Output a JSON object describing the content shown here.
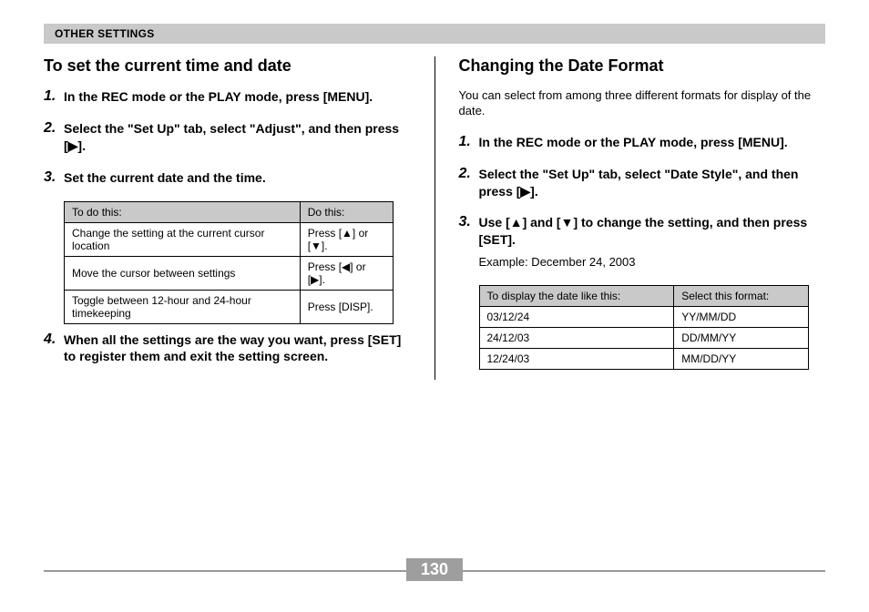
{
  "header": "OTHER SETTINGS",
  "glyph": {
    "up": "▲",
    "down": "▼",
    "left": "◀",
    "right": "▶"
  },
  "left": {
    "title": "To set the current time and date",
    "steps": [
      "In the REC mode or the PLAY mode, press [MENU].",
      "Select the \"Set Up\" tab, select \"Adjust\", and then press [▶].",
      "Set the current date and the time.",
      "When all the settings are the way you want, press [SET] to register them and exit the setting screen."
    ],
    "table": {
      "head": [
        "To do this:",
        "Do this:"
      ],
      "rows": [
        [
          "Change the setting at the current cursor location",
          "Press [▲] or [▼]."
        ],
        [
          "Move the cursor between settings",
          "Press [◀] or [▶]."
        ],
        [
          "Toggle between 12-hour and 24-hour timekeeping",
          "Press [DISP]."
        ]
      ]
    }
  },
  "right": {
    "title": "Changing the Date Format",
    "intro": "You can select from among three different formats for display of the date.",
    "steps": [
      "In the REC mode or the PLAY mode, press [MENU].",
      "Select the \"Set Up\" tab, select \"Date Style\", and then press [▶].",
      "Use [▲] and [▼] to change the setting, and then press [SET]."
    ],
    "example": "Example: December 24, 2003",
    "table": {
      "head": [
        "To display the date like this:",
        "Select this format:"
      ],
      "rows": [
        [
          "03/12/24",
          "YY/MM/DD"
        ],
        [
          "24/12/03",
          "DD/MM/YY"
        ],
        [
          "12/24/03",
          "MM/DD/YY"
        ]
      ]
    }
  },
  "pageNumber": "130"
}
